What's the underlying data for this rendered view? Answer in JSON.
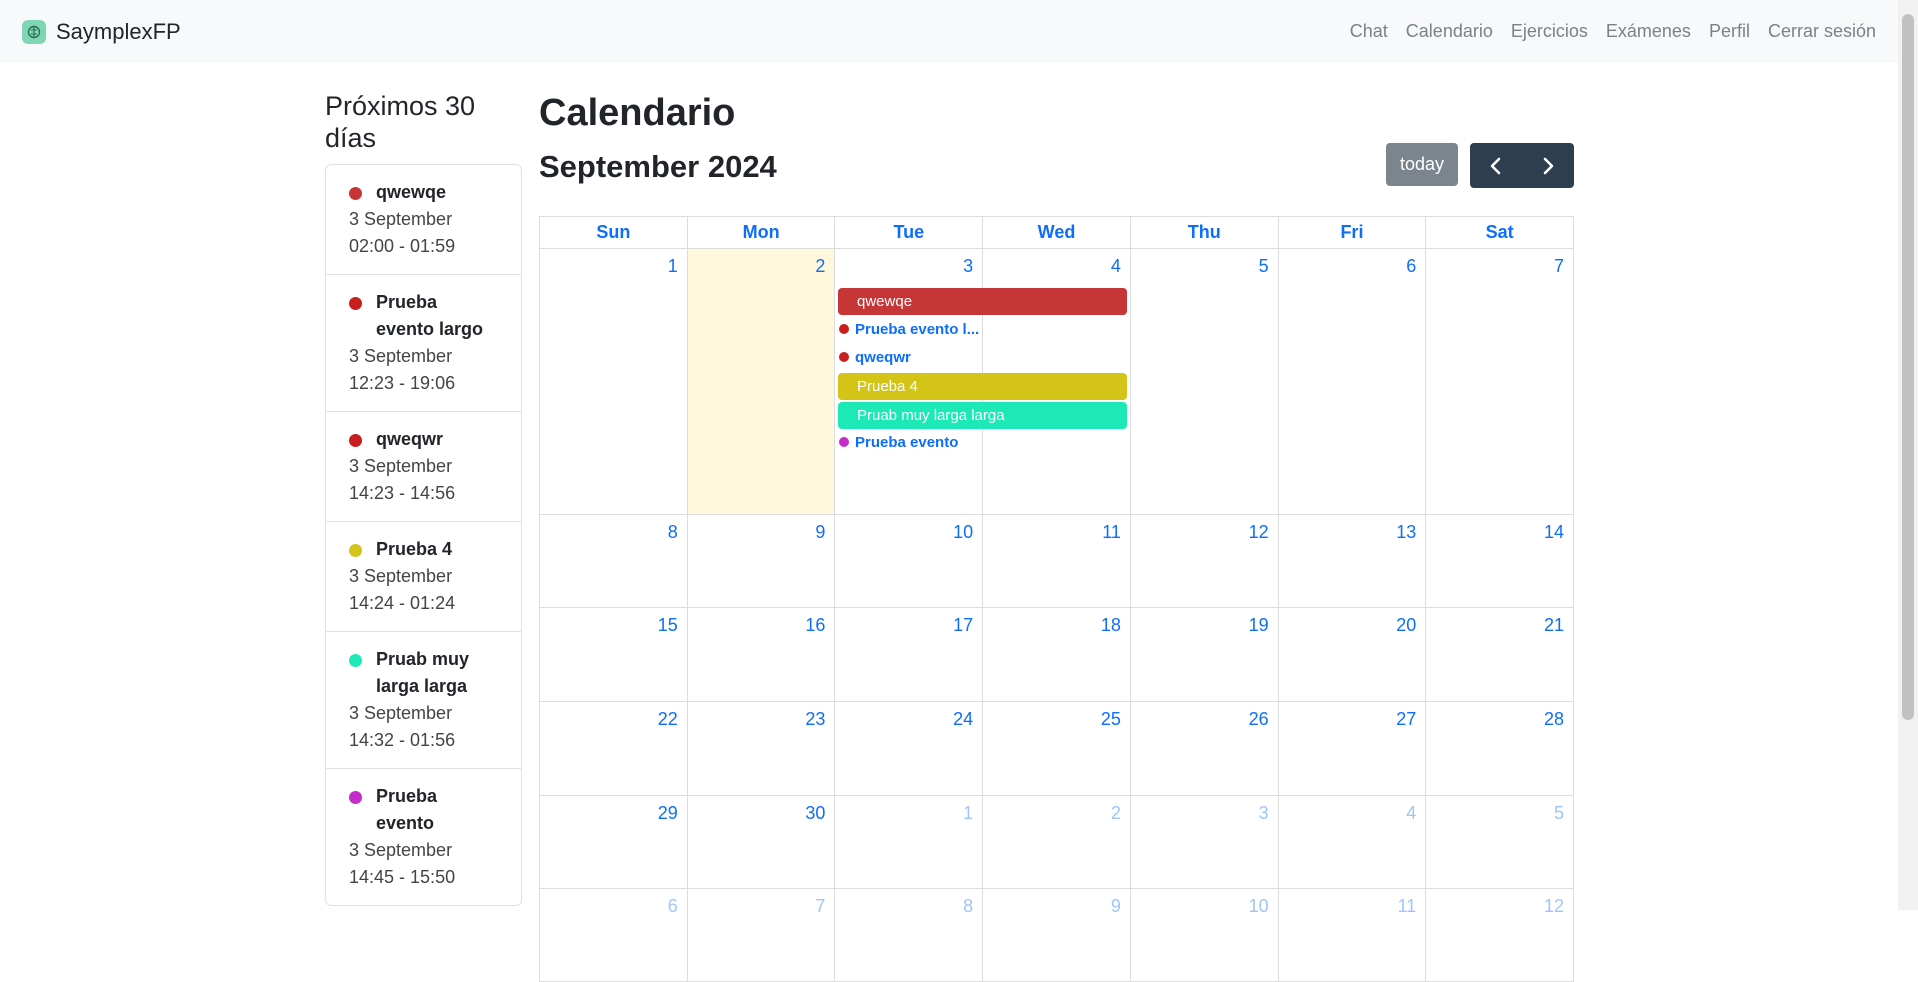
{
  "navbar": {
    "brand": "SaymplexFP",
    "links": [
      "Chat",
      "Calendario",
      "Ejercicios",
      "Exámenes",
      "Perfil",
      "Cerrar sesión"
    ]
  },
  "sidebar": {
    "title": "Próximos 30 días",
    "events": [
      {
        "name": "qwewqe",
        "date": "3 September",
        "time": "02:00 - 01:59",
        "color": "#c73636"
      },
      {
        "name": "Prueba evento largo",
        "date": "3 September",
        "time": "12:23 - 19:06",
        "color": "#c81e1e"
      },
      {
        "name": "qweqwr",
        "date": "3 September",
        "time": "14:23 - 14:56",
        "color": "#c81e1e"
      },
      {
        "name": "Prueba 4",
        "date": "3 September",
        "time": "14:24 - 01:24",
        "color": "#d4c417"
      },
      {
        "name": "Pruab muy larga larga",
        "date": "3 September",
        "time": "14:32 - 01:56",
        "color": "#1de9b6"
      },
      {
        "name": "Prueba evento",
        "date": "3 September",
        "time": "14:45 - 15:50",
        "color": "#c32dc8"
      }
    ]
  },
  "calendar": {
    "page_title": "Calendario",
    "month_title": "September 2024",
    "today_label": "today",
    "prev_icon": "chevron-left-icon",
    "next_icon": "chevron-right-icon",
    "days_of_week": [
      "Sun",
      "Mon",
      "Tue",
      "Wed",
      "Thu",
      "Fri",
      "Sat"
    ],
    "weeks": [
      [
        "1",
        "2",
        "3",
        "4",
        "5",
        "6",
        "7"
      ],
      [
        "8",
        "9",
        "10",
        "11",
        "12",
        "13",
        "14"
      ],
      [
        "15",
        "16",
        "17",
        "18",
        "19",
        "20",
        "21"
      ],
      [
        "22",
        "23",
        "24",
        "25",
        "26",
        "27",
        "28"
      ],
      [
        "29",
        "30",
        "1",
        "2",
        "3",
        "4",
        "5"
      ],
      [
        "6",
        "7",
        "8",
        "9",
        "10",
        "11",
        "12"
      ]
    ],
    "grid_events": [
      {
        "label": "qwewqe",
        "kind": "block",
        "color": "#c73636"
      },
      {
        "label": "Prueba evento l...",
        "kind": "dot",
        "color": "#c81e1e"
      },
      {
        "label": "qweqwr",
        "kind": "dot",
        "color": "#c81e1e"
      },
      {
        "label": "Prueba 4",
        "kind": "block",
        "color": "#d4c417"
      },
      {
        "label": "Pruab muy larga larga",
        "kind": "block",
        "color": "#1de9b6"
      },
      {
        "label": "Prueba evento",
        "kind": "dot",
        "color": "#c32dc8"
      }
    ]
  }
}
